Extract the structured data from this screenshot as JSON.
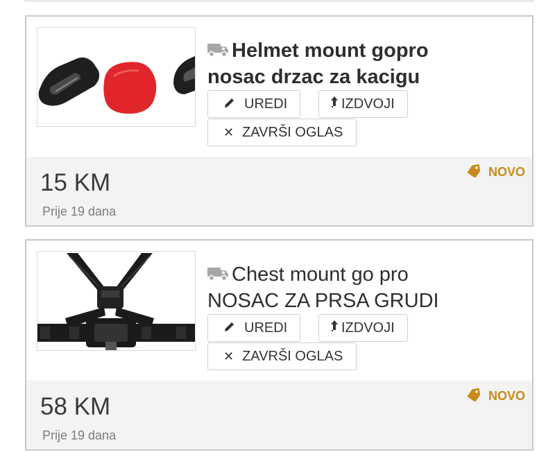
{
  "listings": [
    {
      "title_line1": "Helmet mount gopro",
      "title_line2": "nosac drzac za kacigu",
      "delivery_icon": "truck-icon",
      "actions": {
        "edit_label": "UREDI",
        "edit_icon": "pencil-icon",
        "feature_label": "IZDVOJI",
        "feature_icon": "arrow-up-icon",
        "end_label": "ZAVRŠI OGLAS",
        "end_icon": "close-icon"
      },
      "price": "15 KM",
      "age": "Prije 19 dana",
      "condition": "NOVO",
      "condition_icon": "tag-icon",
      "condition_color": "#c98a1b"
    },
    {
      "title_line1": "Chest mount go pro",
      "title_line2": "NOSAC ZA PRSA GRUDI",
      "delivery_icon": "truck-icon",
      "actions": {
        "edit_label": "UREDI",
        "edit_icon": "pencil-icon",
        "feature_label": "IZDVOJI",
        "feature_icon": "arrow-up-icon",
        "end_label": "ZAVRŠI OGLAS",
        "end_icon": "close-icon"
      },
      "price": "58 KM",
      "age": "Prije 19 dana",
      "condition": "NOVO",
      "condition_icon": "tag-icon",
      "condition_color": "#c98a1b"
    }
  ]
}
